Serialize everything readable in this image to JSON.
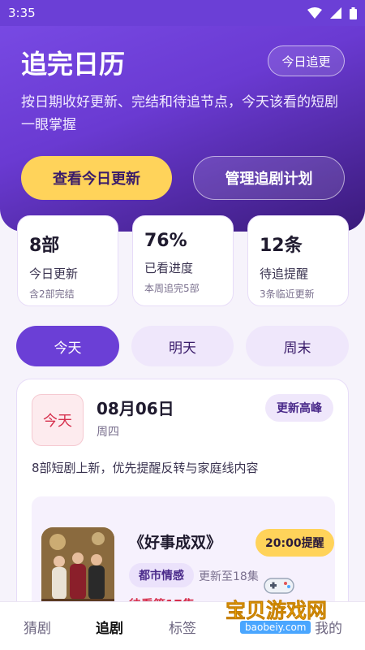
{
  "status_bar": {
    "time": "3:35"
  },
  "hero": {
    "title": "追完日历",
    "chip": "今日追更",
    "subtitle": "按日期收好更新、完结和待追节点，今天该看的短剧一眼掌握",
    "primary_button": "查看今日更新",
    "secondary_button": "管理追剧计划"
  },
  "stats": [
    {
      "value": "8部",
      "label": "今日更新",
      "note": "含2部完结"
    },
    {
      "value": "76%",
      "label": "已看进度",
      "note": "本周追完5部"
    },
    {
      "value": "12条",
      "label": "待追提醒",
      "note": "3条临近更新"
    }
  ],
  "tabs": [
    {
      "label": "今天",
      "active": true
    },
    {
      "label": "明天",
      "active": false
    },
    {
      "label": "周末",
      "active": false
    }
  ],
  "day_card": {
    "badge": "今天",
    "date": "08月06日",
    "weekday": "周四",
    "tag": "更新高峰",
    "description": "8部短剧上新，优先提醒反转与家庭线内容",
    "show": {
      "title": "《好事成双》",
      "remind": "20:00提醒",
      "genre": "都市情感",
      "update": "更新至18集",
      "watch_next": "待看第17集"
    }
  },
  "bottom_nav": [
    {
      "label": "猜剧",
      "active": false
    },
    {
      "label": "追剧",
      "active": true
    },
    {
      "label": "标签",
      "active": false
    },
    {
      "label": "我的",
      "active": false
    }
  ],
  "watermark": {
    "text": "宝贝游戏网",
    "url": "baobeiy.com"
  },
  "colors": {
    "primary": "#6b3fd6",
    "accent": "#ffd35a",
    "alert": "#d6304d"
  }
}
